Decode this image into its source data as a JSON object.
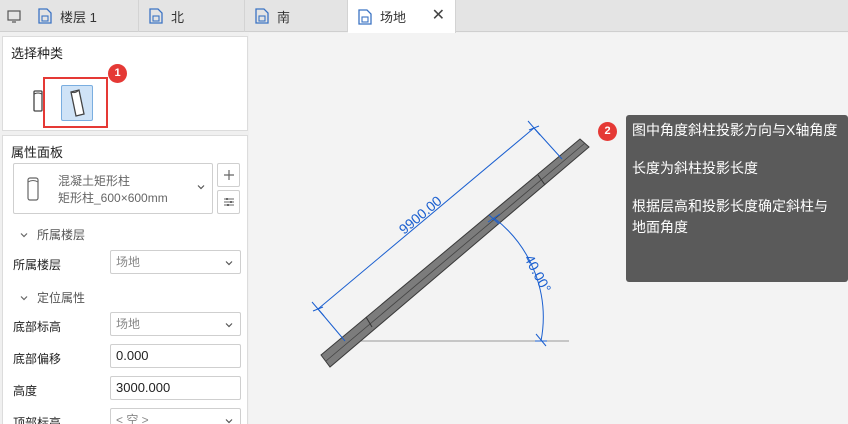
{
  "tabs": [
    {
      "label": ""
    },
    {
      "label": "楼层 1"
    },
    {
      "label": "北"
    },
    {
      "label": "南"
    },
    {
      "label": "场地",
      "active": true
    }
  ],
  "select_kind": {
    "title": "选择种类",
    "badge": "1"
  },
  "properties": {
    "title": "属性面板",
    "type_name": "混凝土矩形柱",
    "type_spec": "矩形柱_600×600mm",
    "section_floor": "所属楼层",
    "floor_label": "所属楼层",
    "floor_value": "场地",
    "section_position": "定位属性",
    "bottom_elev_label": "底部标高",
    "bottom_elev_value": "场地",
    "bottom_offset_label": "底部偏移",
    "bottom_offset_value": "0.000",
    "height_label": "高度",
    "height_value": "3000.000",
    "top_elev_label": "顶部标高",
    "top_elev_value": "< 空 >"
  },
  "drawing": {
    "length_dim": "9900.00",
    "angle_dim": "40.00°",
    "accent_color": "#1a5fd0"
  },
  "tooltip": {
    "badge": "2",
    "line1": "图中角度斜柱投影方向与X轴角度",
    "line2": "长度为斜柱投影长度",
    "line3": "根据层高和投影长度确定斜柱与地面角度"
  }
}
